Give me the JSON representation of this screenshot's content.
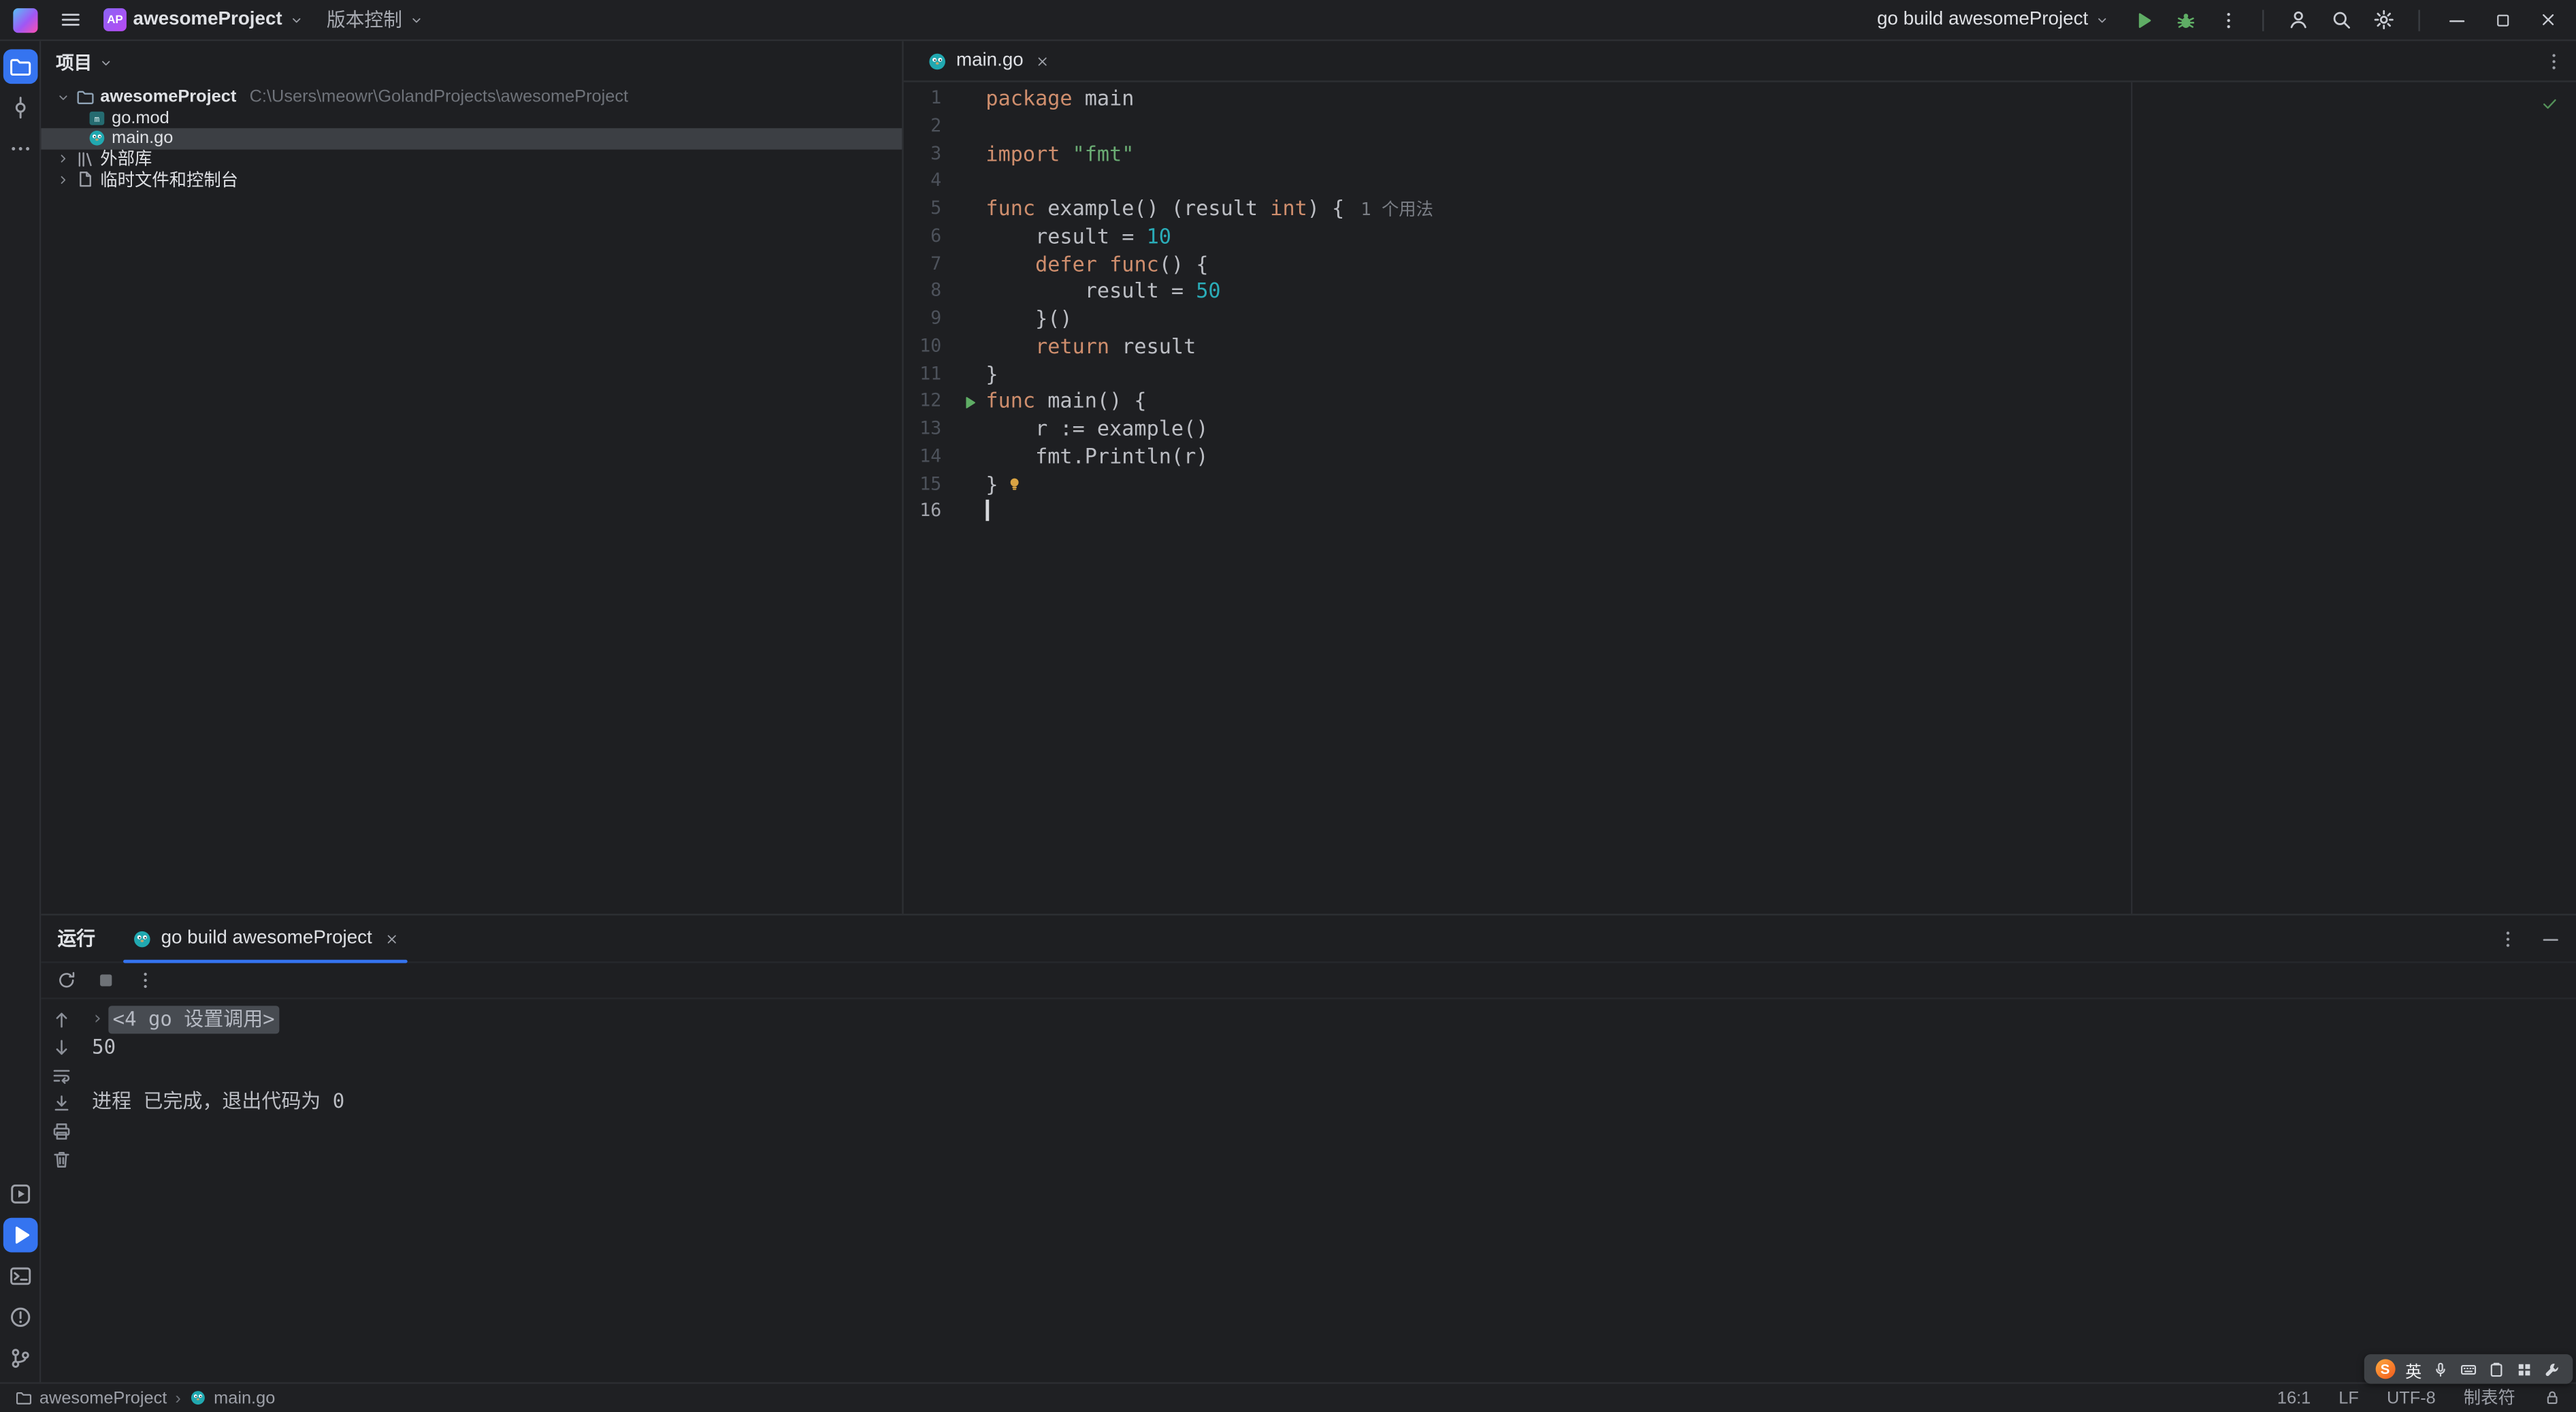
{
  "titlebar": {
    "project": {
      "badge": "AP",
      "name": "awesomeProject"
    },
    "vcs_label": "版本控制",
    "run_config": "go build awesomeProject",
    "icons": [
      "hamburger",
      "chevron-down",
      "run",
      "debug",
      "more-vertical",
      "account",
      "search",
      "settings",
      "minimize",
      "maximize",
      "close"
    ]
  },
  "activity_bar": {
    "top": [
      "project",
      "commit",
      "more"
    ],
    "bottom": [
      "services",
      "run",
      "terminal",
      "problems",
      "version-control"
    ],
    "active_top": "project",
    "active_bottom": "run"
  },
  "project_panel": {
    "title": "项目",
    "tree": [
      {
        "level": 0,
        "chevron": "down",
        "icon": "folder",
        "label": "awesomeProject",
        "path": "C:\\Users\\meowr\\GolandProjects\\awesomeProject",
        "bold": true
      },
      {
        "level": 1,
        "icon": "go-mod",
        "label": "go.mod"
      },
      {
        "level": 1,
        "icon": "go-file",
        "label": "main.go",
        "selected": true
      },
      {
        "level": 0,
        "chevron": "right",
        "icon": "library",
        "label": "外部库"
      },
      {
        "level": 0,
        "chevron": "right",
        "icon": "scratch",
        "label": "临时文件和控制台"
      }
    ]
  },
  "editor": {
    "tab": {
      "label": "main.go",
      "icon": "go-file"
    },
    "inspection_status": "ok",
    "inlay_hint": "1 个用法",
    "caret_position": {
      "line": 16,
      "column": 1
    },
    "code": [
      {
        "n": 1,
        "t": [
          [
            "k",
            "package"
          ],
          [
            "p",
            " main"
          ]
        ]
      },
      {
        "n": 2,
        "t": []
      },
      {
        "n": 3,
        "t": [
          [
            "k",
            "import"
          ],
          [
            "p",
            " "
          ],
          [
            "s",
            "\"fmt\""
          ]
        ]
      },
      {
        "n": 4,
        "t": []
      },
      {
        "n": 5,
        "t": [
          [
            "k",
            "func"
          ],
          [
            "p",
            " example() (result "
          ],
          [
            "k",
            "int"
          ],
          [
            "p",
            ") {"
          ],
          [
            "h",
            "1 个用法"
          ]
        ]
      },
      {
        "n": 6,
        "t": [
          [
            "p",
            "    result = "
          ],
          [
            "n",
            "10"
          ]
        ]
      },
      {
        "n": 7,
        "t": [
          [
            "p",
            "    "
          ],
          [
            "k",
            "defer"
          ],
          [
            "p",
            " "
          ],
          [
            "k",
            "func"
          ],
          [
            "p",
            "() {"
          ]
        ]
      },
      {
        "n": 8,
        "t": [
          [
            "p",
            "        result = "
          ],
          [
            "n",
            "50"
          ]
        ]
      },
      {
        "n": 9,
        "t": [
          [
            "p",
            "    }()"
          ]
        ]
      },
      {
        "n": 10,
        "t": [
          [
            "p",
            "    "
          ],
          [
            "k",
            "return"
          ],
          [
            "p",
            " result"
          ]
        ]
      },
      {
        "n": 11,
        "t": [
          [
            "p",
            "}"
          ]
        ]
      },
      {
        "n": 12,
        "t": [
          [
            "k",
            "func"
          ],
          [
            "p",
            " main() {"
          ]
        ],
        "run": true
      },
      {
        "n": 13,
        "t": [
          [
            "p",
            "    r := example()"
          ]
        ]
      },
      {
        "n": 14,
        "t": [
          [
            "p",
            "    fmt.Println(r)"
          ]
        ]
      },
      {
        "n": 15,
        "t": [
          [
            "p",
            "}"
          ]
        ],
        "bulb": true
      },
      {
        "n": 16,
        "t": [],
        "caret": true
      }
    ]
  },
  "run_window": {
    "title": "运行",
    "tab": {
      "label": "go build awesomeProject",
      "icon": "go-file"
    },
    "toolbar": [
      "rerun",
      "stop",
      "more"
    ],
    "gutter_icons": [
      "up",
      "down",
      "soft-wrap",
      "scroll-end",
      "print",
      "clear"
    ],
    "console": [
      {
        "fold": true,
        "text": "<4 go 设置调用>"
      },
      {
        "text": "50"
      },
      {
        "text": ""
      },
      {
        "text": "进程 已完成，退出代码为 0"
      }
    ]
  },
  "status_bar": {
    "breadcrumbs": [
      {
        "icon": "folder",
        "label": "awesomeProject"
      },
      {
        "icon": "go-file",
        "label": "main.go"
      }
    ],
    "right": [
      {
        "name": "caret-position",
        "label": "16:1"
      },
      {
        "name": "line-separator",
        "label": "LF"
      },
      {
        "name": "file-encoding",
        "label": "UTF-8"
      },
      {
        "name": "indent-style",
        "label": "制表符"
      },
      {
        "name": "readonly-lock",
        "icon": "lock"
      }
    ]
  },
  "ime_bar": {
    "logo": "S",
    "lang": "英",
    "icons": [
      "mic",
      "keyboard",
      "clipboard",
      "grid",
      "wrench"
    ]
  },
  "colors": {
    "accent": "#3574F0",
    "run_green": "#5FAD65",
    "keyword": "#CF8E6D",
    "string": "#6AAB73",
    "number": "#2AACB8",
    "editor_fg": "#BCBEC4",
    "editor_bg": "#1E1F22"
  }
}
